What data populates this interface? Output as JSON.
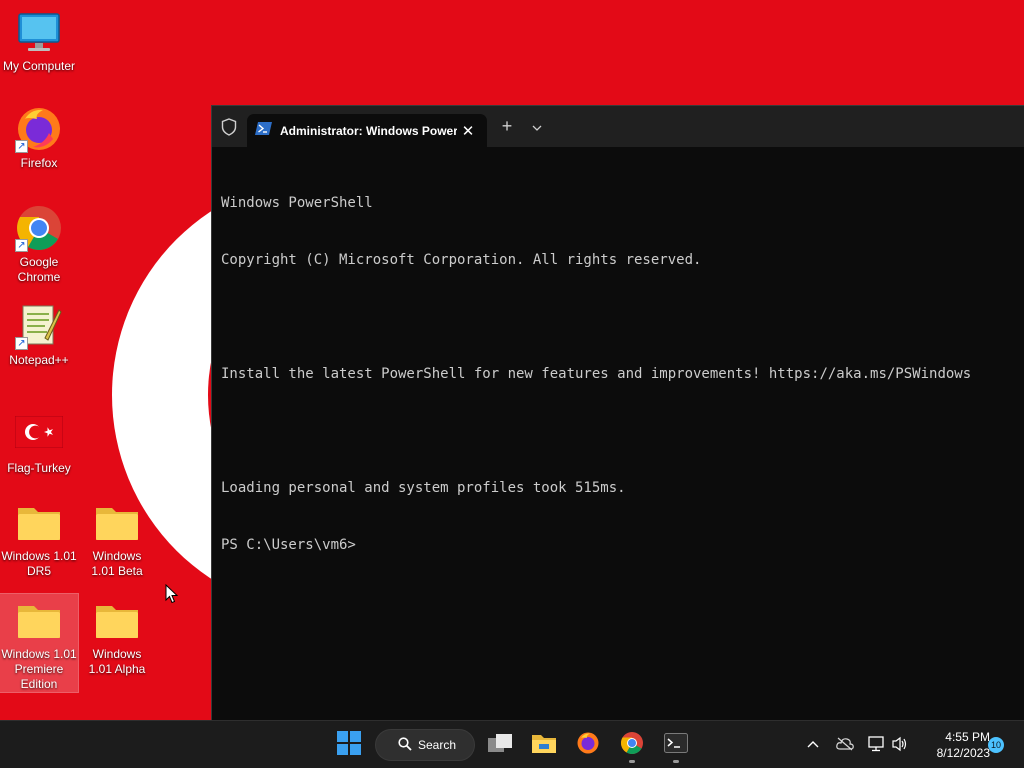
{
  "desktop": {
    "icons": [
      {
        "label": "My Computer",
        "icon": "monitor-icon"
      },
      {
        "label": "Firefox",
        "icon": "firefox-icon"
      },
      {
        "label": "Google Chrome",
        "icon": "chrome-icon"
      },
      {
        "label": "Notepad++",
        "icon": "notepadpp-icon"
      },
      {
        "label": "Flag-Turkey",
        "icon": "flag-turkey-icon"
      },
      {
        "label": "Windows 1.01 DR5",
        "icon": "folder-icon"
      },
      {
        "label": "Windows 1.01 Beta",
        "icon": "folder-icon"
      },
      {
        "label": "Windows 1.01 Premiere Edition",
        "icon": "folder-icon"
      },
      {
        "label": "Windows 1.01 Alpha",
        "icon": "folder-icon"
      }
    ],
    "wallpaper_color": "#e30a17"
  },
  "terminal": {
    "tab_title": "Administrator: Windows PowerShell",
    "tab_close": "✕",
    "new_tab": "+",
    "lines": [
      "Windows PowerShell",
      "Copyright (C) Microsoft Corporation. All rights reserved.",
      "",
      "Install the latest PowerShell for new features and improvements! https://aka.ms/PSWindows",
      "",
      "Loading personal and system profiles took 515ms.",
      "PS C:\\Users\\vm6>"
    ]
  },
  "taskbar": {
    "search_label": "Search",
    "time": "4:55 PM",
    "date": "8/12/2023",
    "notification_count": "10",
    "accent_color": "#4cc2ff"
  }
}
